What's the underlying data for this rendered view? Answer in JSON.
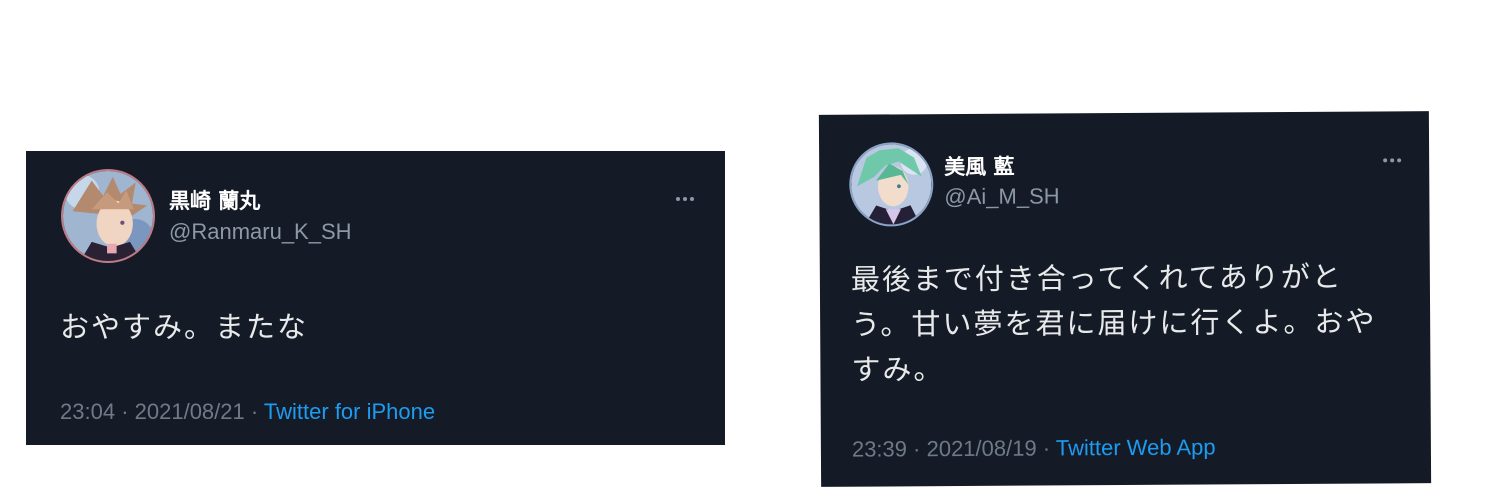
{
  "tweets": [
    {
      "display_name": "黒崎 蘭丸",
      "handle": "@Ranmaru_K_SH",
      "text": "おやすみ。またな",
      "time": "23:04",
      "separator": "·",
      "date": "2021/08/21",
      "source": "Twitter for iPhone",
      "avatar_icon": "avatar-ranmaru-icon",
      "more_icon": "more-options-icon"
    },
    {
      "display_name": "美風 藍",
      "handle": "@Ai_M_SH",
      "text_lines": [
        "最後まで付き合ってくれてありがと",
        "う。甘い夢を君に届けに行くよ。おや",
        "すみ。"
      ],
      "time": "23:39",
      "separator": "·",
      "date": "2021/08/19",
      "source": "Twitter Web App",
      "avatar_icon": "avatar-ai-icon",
      "more_icon": "more-options-icon"
    }
  ],
  "colors": {
    "card_background": "#151b26",
    "name": "#ffffff",
    "handle": "#8b98a5",
    "text": "#e7e9ea",
    "meta": "#6e7a86",
    "link": "#1d9bf0"
  }
}
